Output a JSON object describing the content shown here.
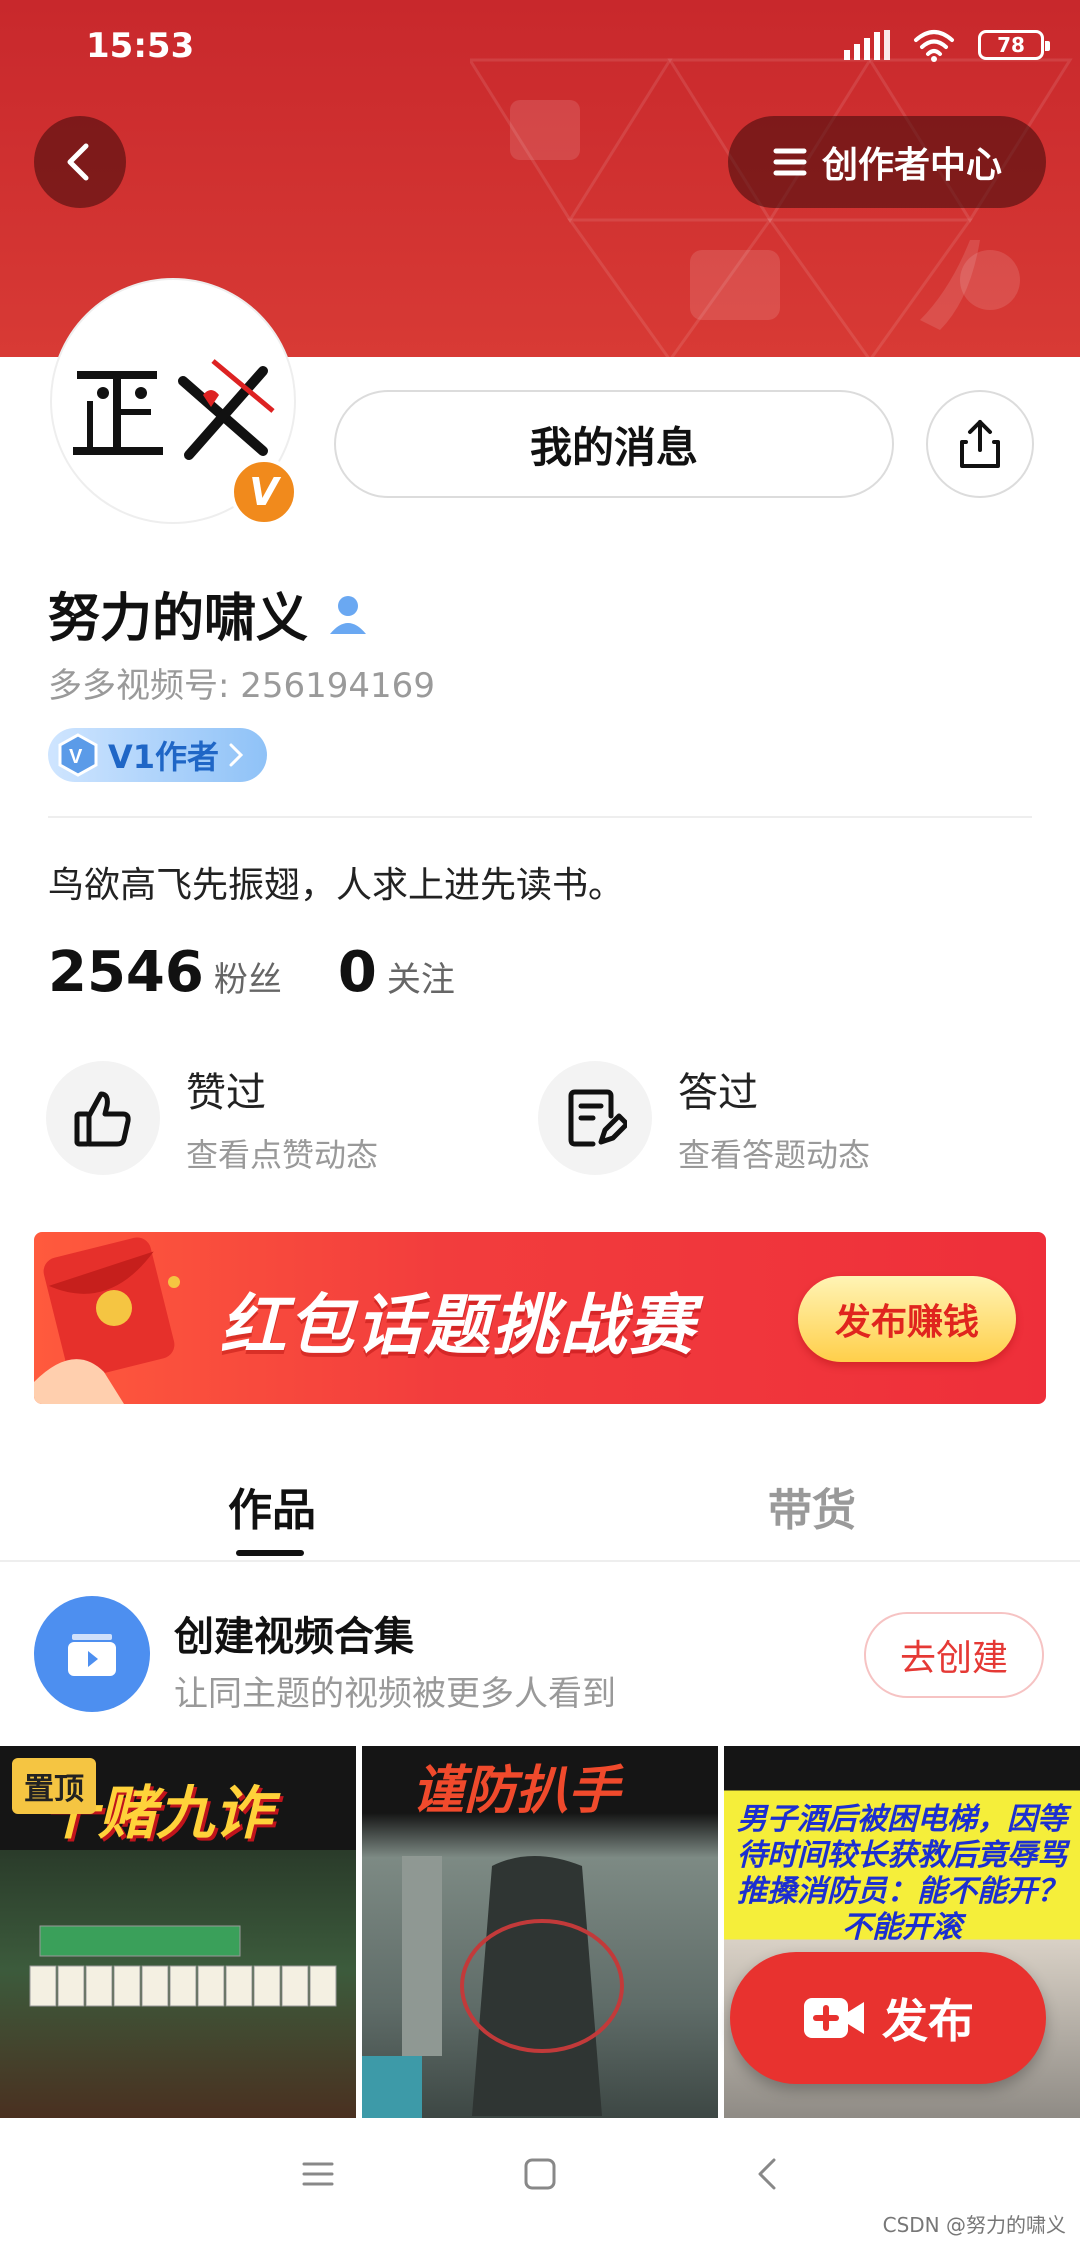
{
  "status_bar": {
    "time": "15:53",
    "battery": "78"
  },
  "header": {
    "creator_center_label": "创作者中心"
  },
  "profile": {
    "message_button": "我的消息",
    "name": "努力的啸义",
    "video_id": "多多视频号: 256194169",
    "level_badge": "V1作者",
    "bio": "鸟欲高飞先振翅，人求上进先读书。",
    "fans_count": "2546",
    "fans_label": "粉丝",
    "following_count": "0",
    "following_label": "关注",
    "avatar_text": "正 义"
  },
  "actions": [
    {
      "title": "赞过",
      "subtitle": "查看点赞动态"
    },
    {
      "title": "答过",
      "subtitle": "查看答题动态"
    }
  ],
  "promo": {
    "title": "红包话题挑战赛",
    "button": "发布赚钱"
  },
  "tabs": [
    {
      "label": "作品"
    },
    {
      "label": "带货"
    }
  ],
  "collection": {
    "title": "创建视频合集",
    "subtitle": "让同主题的视频被更多人看到",
    "button": "去创建"
  },
  "videos": [
    {
      "caption": "十赌九诈",
      "pinned_label": "置顶"
    },
    {
      "caption": "谨防扒手"
    },
    {
      "caption": "男子酒后被困电梯，因等待时间较长获救后竟辱骂推搡消防员：能不能开？不能开滚"
    }
  ],
  "publish_button": "发布",
  "watermark": "CSDN @努力的啸义",
  "colors": {
    "accent_red": "#e8322f",
    "banner_red": "#d83a35",
    "blue": "#4d8ff0"
  }
}
